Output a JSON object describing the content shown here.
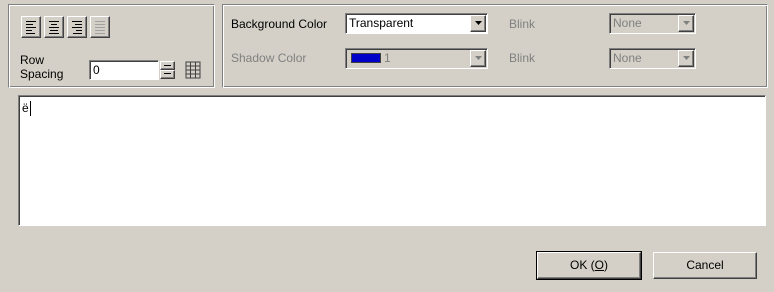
{
  "toolbar": {
    "align_buttons": [
      {
        "name": "align-left",
        "disabled": false
      },
      {
        "name": "align-center",
        "disabled": false
      },
      {
        "name": "align-right",
        "disabled": false
      },
      {
        "name": "align-justify",
        "disabled": true
      }
    ],
    "row_spacing_label_1": "Row",
    "row_spacing_label_2": "Spacing",
    "row_spacing_value": "0"
  },
  "colors": {
    "background_color_label": "Background Color",
    "background_color_value": "Transparent",
    "blink_label_1": "Blink",
    "blink_value_1": "None",
    "shadow_color_label": "Shadow Color",
    "shadow_color_value": "1",
    "shadow_swatch": "#0000c8",
    "blink_label_2": "Blink",
    "blink_value_2": "None"
  },
  "editor": {
    "text": "ë"
  },
  "buttons": {
    "ok_prefix": "OK (",
    "ok_key": "O",
    "ok_suffix": ")",
    "cancel_label": "Cancel"
  }
}
